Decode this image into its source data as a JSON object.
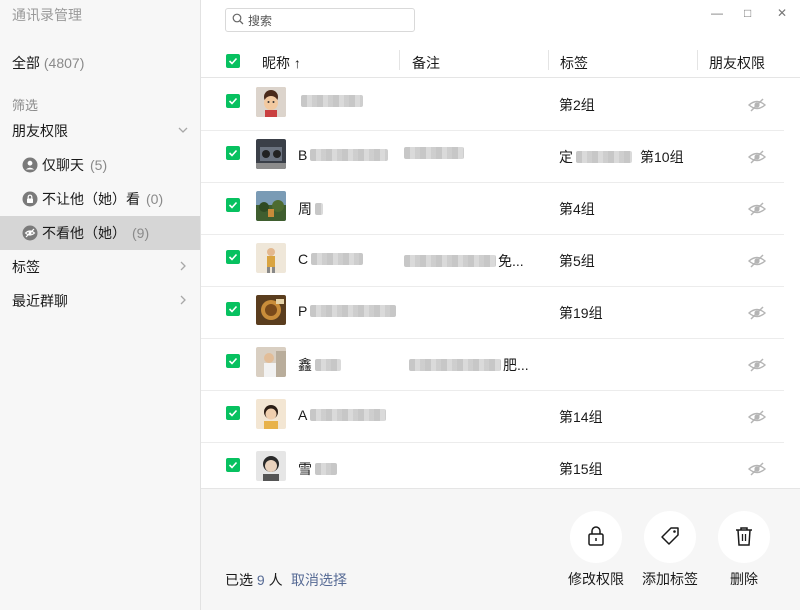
{
  "window": {
    "title": "通讯录管理",
    "minimize": "—",
    "maximize": "□",
    "close": "✕"
  },
  "sidebar": {
    "all": {
      "label": "全部",
      "count": "(4807)"
    },
    "filter_label": "筛选",
    "friend_perm": {
      "label": "朋友权限"
    },
    "sub_items": [
      {
        "label": "仅聊天",
        "count": "(5)"
      },
      {
        "label": "不让他（她）看",
        "count": "(0)"
      },
      {
        "label": "不看他（她）",
        "count": "(9)"
      }
    ],
    "tags": {
      "label": "标签"
    },
    "groups": {
      "label": "最近群聊"
    }
  },
  "search": {
    "placeholder": "搜索"
  },
  "table": {
    "headers": {
      "nickname": "昵称",
      "sort": "↑",
      "remark": "备注",
      "tag": "标签",
      "perm": "朋友权限"
    },
    "rows": [
      {
        "nick_prefix": "",
        "remark_suffix": "",
        "tag": "第2组"
      },
      {
        "nick_prefix": "B",
        "remark_suffix": "",
        "tag_prefix": "定",
        "tag": "第10组"
      },
      {
        "nick_prefix": "周",
        "remark_suffix": "",
        "tag": "第4组"
      },
      {
        "nick_prefix": "C",
        "remark_suffix": "免...",
        "tag": "第5组"
      },
      {
        "nick_prefix": "P",
        "remark_suffix": "",
        "tag": "第19组"
      },
      {
        "nick_prefix": "鑫",
        "remark_suffix": "肥...",
        "tag": ""
      },
      {
        "nick_prefix": "A",
        "remark_suffix": "",
        "tag": "第14组"
      },
      {
        "nick_prefix": "雪",
        "remark_suffix": "",
        "tag": "第15组"
      }
    ]
  },
  "footer": {
    "selected_prefix": "已选",
    "selected_count": "9",
    "selected_suffix": "人",
    "cancel_label": "取消选择",
    "actions": {
      "modify": "修改权限",
      "add_tag": "添加标签",
      "delete": "删除"
    }
  }
}
